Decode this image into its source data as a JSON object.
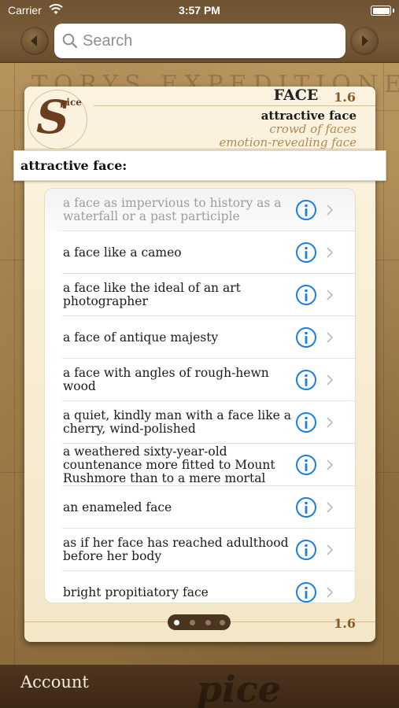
{
  "status": {
    "carrier": "Carrier",
    "time": "3:57 PM"
  },
  "search": {
    "placeholder": "Search"
  },
  "background": {
    "map_text": "TORYS EXPEDITIONES NAV"
  },
  "logo": {
    "initial": "S",
    "text": "pice"
  },
  "header": {
    "title": "FACE",
    "number": "1.6",
    "related": [
      "attractive face",
      "crowd of faces",
      "emotion-revealing face"
    ]
  },
  "topic": {
    "label": "attractive face:"
  },
  "list": [
    {
      "text": "a face as impervious to history as a waterfall or a past participle",
      "faded": true
    },
    {
      "text": "a face like a cameo",
      "faded": false
    },
    {
      "text": "a face like the ideal of an art photographer",
      "faded": false
    },
    {
      "text": "a face of antique majesty",
      "faded": false
    },
    {
      "text": "a face with angles of rough-hewn wood",
      "faded": false
    },
    {
      "text": "a quiet, kindly man with a face like a cherry, wind-polished",
      "faded": false
    },
    {
      "text": "a weathered sixty-year-old countenance more fitted to Mount Rushmore than to a mere mortal",
      "faded": false
    },
    {
      "text": "an enameled face",
      "faded": false
    },
    {
      "text": "as if her face has reached adulthood before her body",
      "faded": false
    },
    {
      "text": "bright propitiatory face",
      "faded": false
    }
  ],
  "footer": {
    "number": "1.6",
    "pages": 4,
    "current_page": 1
  },
  "bottom": {
    "account_label": "Account",
    "logo_text": "pice"
  },
  "colors": {
    "accent_blue": "#1a7fe0",
    "leather": "#6e5232",
    "parchment": "#f4e7c8",
    "header_number": "#8a5a26"
  }
}
